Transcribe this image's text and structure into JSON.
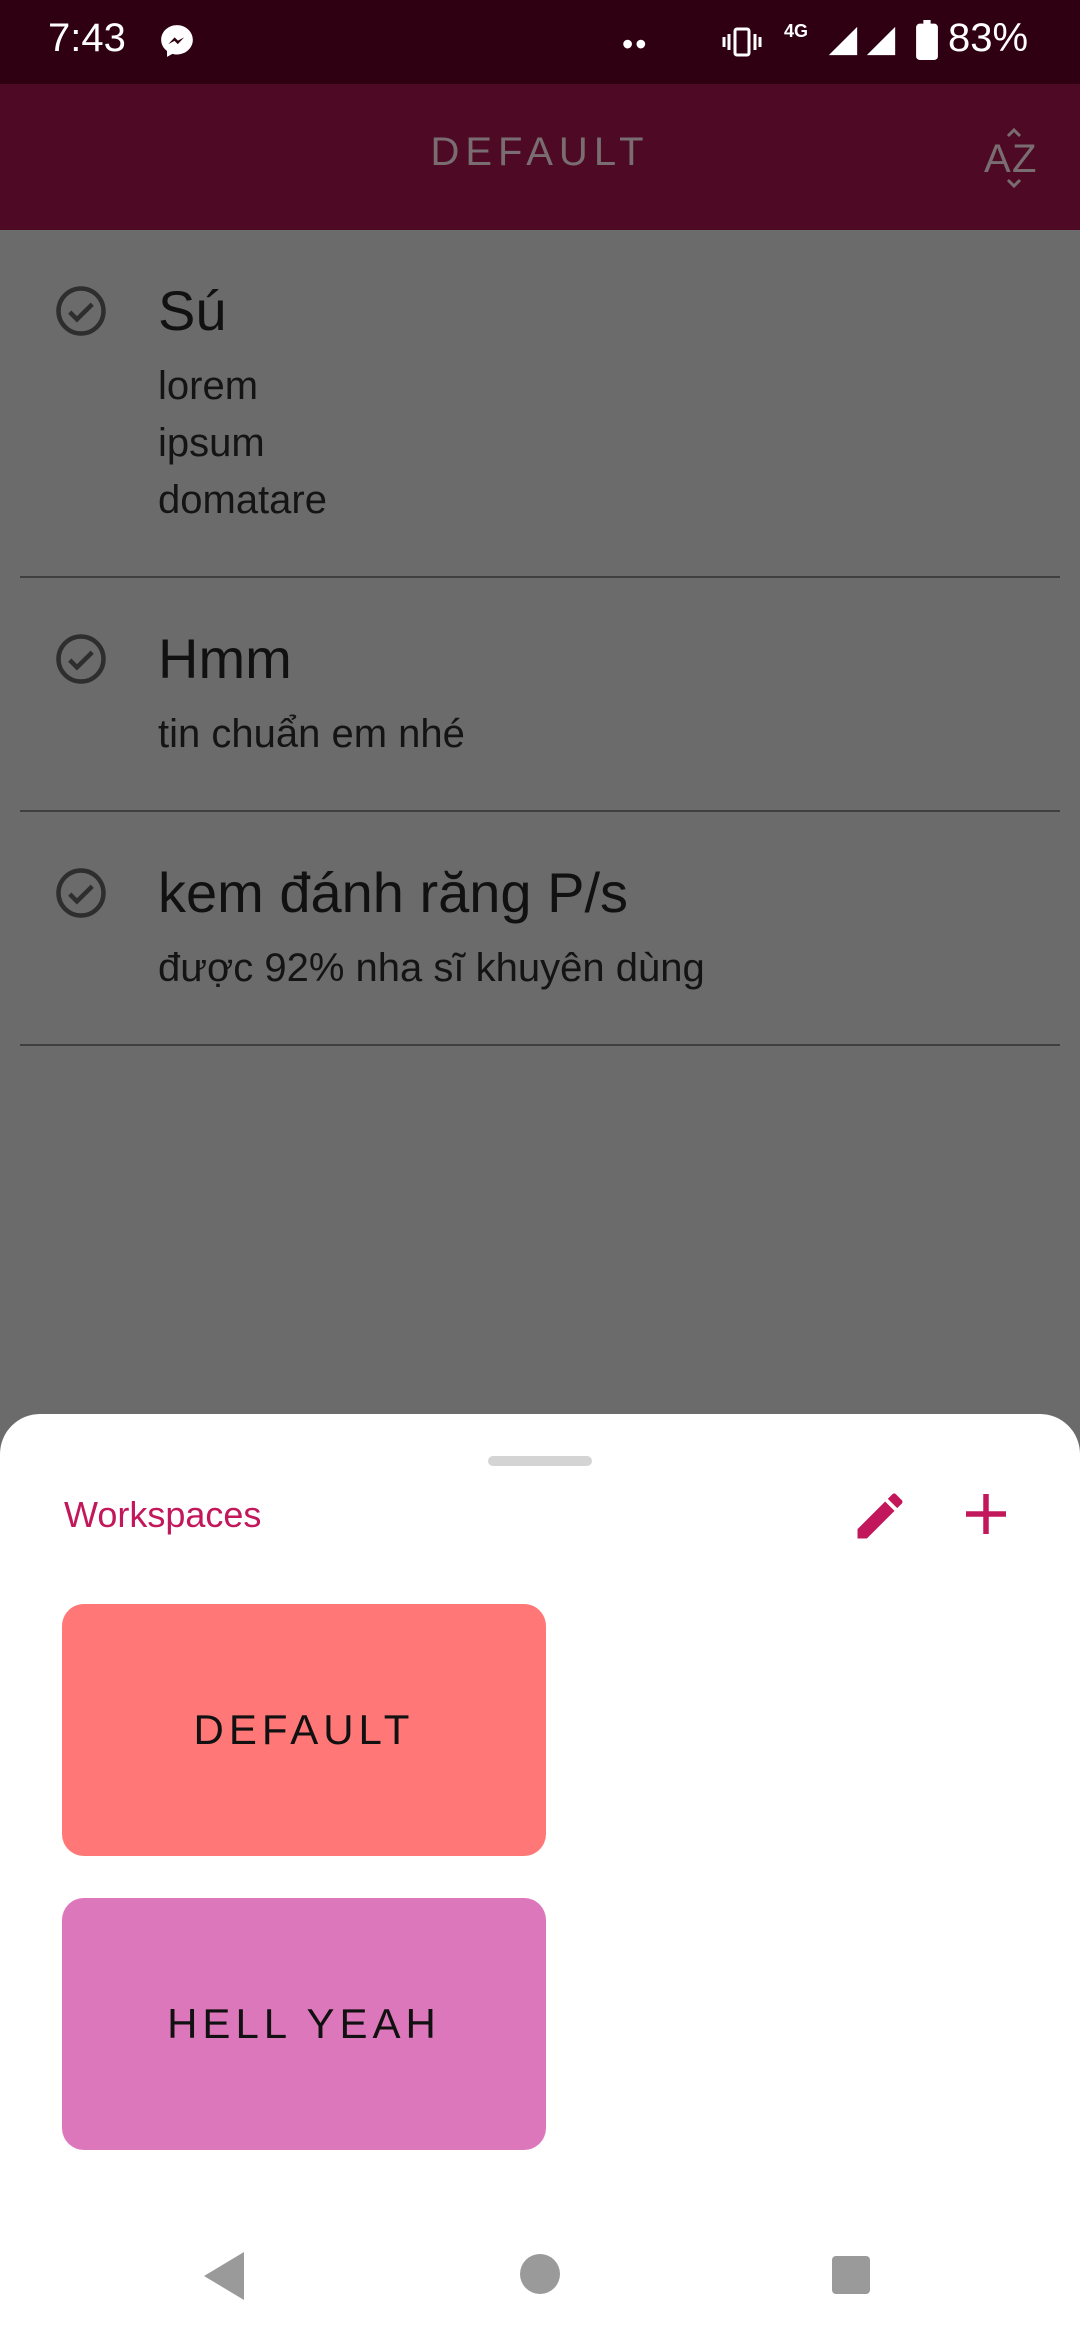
{
  "status_bar": {
    "time": "7:43",
    "dots": "••",
    "network": "4G",
    "battery": "83%"
  },
  "app_bar": {
    "title": "DEFAULT",
    "sort_icon": "sort-az-icon"
  },
  "notes": [
    {
      "title": "Sú",
      "body": "lorem\nipsum\ndomatare"
    },
    {
      "title": "Hmm",
      "body": "tin chuẩn em nhé"
    },
    {
      "title": "kem đánh răng P/s",
      "body": "được 92% nha sĩ khuyên dùng"
    }
  ],
  "sheet": {
    "title": "Workspaces",
    "edit_icon": "pencil-icon",
    "add_icon": "plus-icon",
    "workspaces": [
      {
        "label": "DEFAULT",
        "color": "#ff7777"
      },
      {
        "label": "HELL YEAH",
        "color": "#dd77bb"
      }
    ]
  },
  "colors": {
    "status_bar": "#2f0012",
    "app_bar": "#4e0a24",
    "scrim": "#6b6b6b",
    "accent": "#c2185b"
  }
}
